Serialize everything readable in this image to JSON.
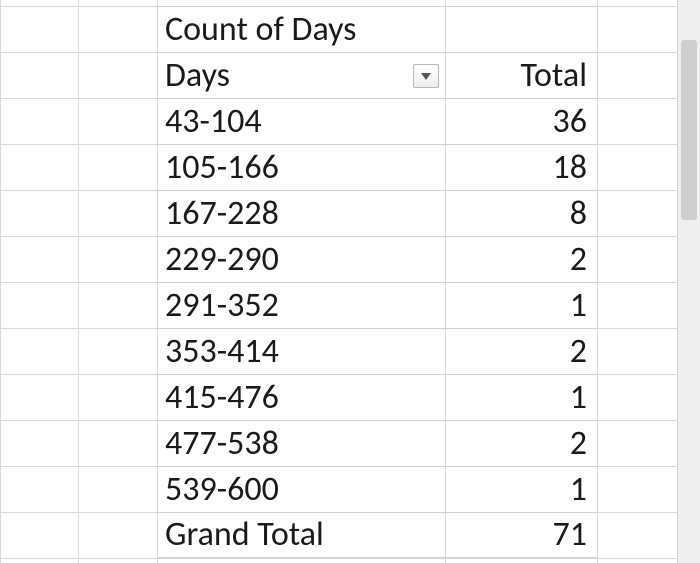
{
  "pivot": {
    "title": "Count of Days",
    "row_field_label": "Days",
    "value_header": "Total",
    "rows": [
      {
        "label": "43-104",
        "value": "36"
      },
      {
        "label": "105-166",
        "value": "18"
      },
      {
        "label": "167-228",
        "value": "8"
      },
      {
        "label": "229-290",
        "value": "2"
      },
      {
        "label": "291-352",
        "value": "1"
      },
      {
        "label": "353-414",
        "value": "2"
      },
      {
        "label": "415-476",
        "value": "1"
      },
      {
        "label": "477-538",
        "value": "2"
      },
      {
        "label": "539-600",
        "value": "1"
      }
    ],
    "grand_total_label": "Grand Total",
    "grand_total_value": "71"
  },
  "chart_data": {
    "type": "table",
    "title": "Count of Days",
    "columns": [
      "Days",
      "Total"
    ],
    "rows": [
      [
        "43-104",
        36
      ],
      [
        "105-166",
        18
      ],
      [
        "167-228",
        8
      ],
      [
        "229-290",
        2
      ],
      [
        "291-352",
        1
      ],
      [
        "353-414",
        2
      ],
      [
        "415-476",
        1
      ],
      [
        "477-538",
        2
      ],
      [
        "539-600",
        1
      ]
    ],
    "grand_total": 71
  }
}
